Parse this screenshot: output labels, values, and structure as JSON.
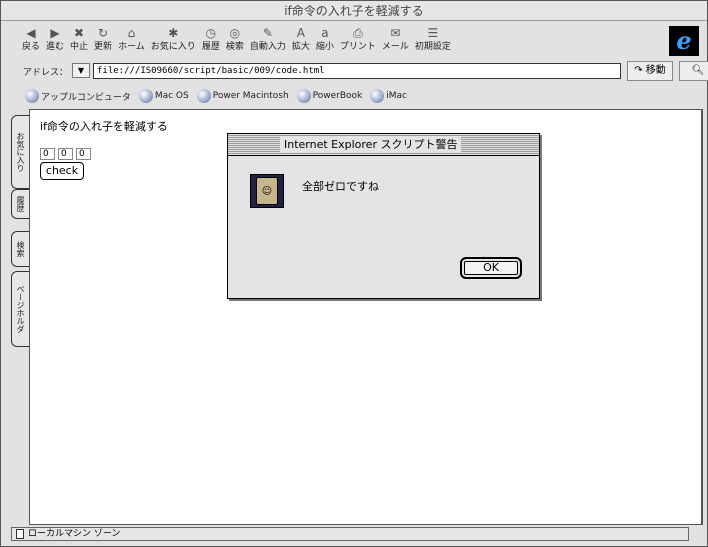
{
  "window": {
    "title": "if命令の入れ子を軽減する"
  },
  "toolbar": {
    "items": [
      {
        "label": "戻る",
        "icon": "back-arrow-icon",
        "glyph": "◀"
      },
      {
        "label": "進む",
        "icon": "forward-arrow-icon",
        "glyph": "▶"
      },
      {
        "label": "中止",
        "icon": "stop-icon",
        "glyph": "✖"
      },
      {
        "label": "更新",
        "icon": "refresh-icon",
        "glyph": "↻"
      },
      {
        "label": "ホーム",
        "icon": "home-icon",
        "glyph": "⌂"
      },
      {
        "label": "お気に入り",
        "icon": "favorites-icon",
        "glyph": "✱"
      },
      {
        "label": "履歴",
        "icon": "history-icon",
        "glyph": "◷"
      },
      {
        "label": "検索",
        "icon": "search-icon",
        "glyph": "◎"
      },
      {
        "label": "自動入力",
        "icon": "autofill-icon",
        "glyph": "✎"
      },
      {
        "label": "拡大",
        "icon": "larger-text-icon",
        "glyph": "A"
      },
      {
        "label": "縮小",
        "icon": "smaller-text-icon",
        "glyph": "a"
      },
      {
        "label": "プリント",
        "icon": "print-icon",
        "glyph": "⎙"
      },
      {
        "label": "メール",
        "icon": "mail-icon",
        "glyph": "✉"
      },
      {
        "label": "初期設定",
        "icon": "preferences-icon",
        "glyph": "☰"
      }
    ]
  },
  "address": {
    "label": "アドレス：",
    "value": "file:///IS09660/script/basic/009/code.html",
    "go_label": "移動"
  },
  "favorites": [
    "アップルコンピュータ",
    "Mac OS",
    "Power Macintosh",
    "PowerBook",
    "iMac"
  ],
  "sidetabs": [
    "お気に入り",
    "履歴",
    "検索",
    "ページホルダ"
  ],
  "page": {
    "heading": "if命令の入れ子を軽減する",
    "inputs": [
      "0",
      "0",
      "0"
    ],
    "check_label": "check"
  },
  "dialog": {
    "title": "Internet Explorer スクリプト警告",
    "message": "全部ゼロですね",
    "ok_label": "OK"
  },
  "status": {
    "zone": "ローカルマシン ゾーン"
  }
}
